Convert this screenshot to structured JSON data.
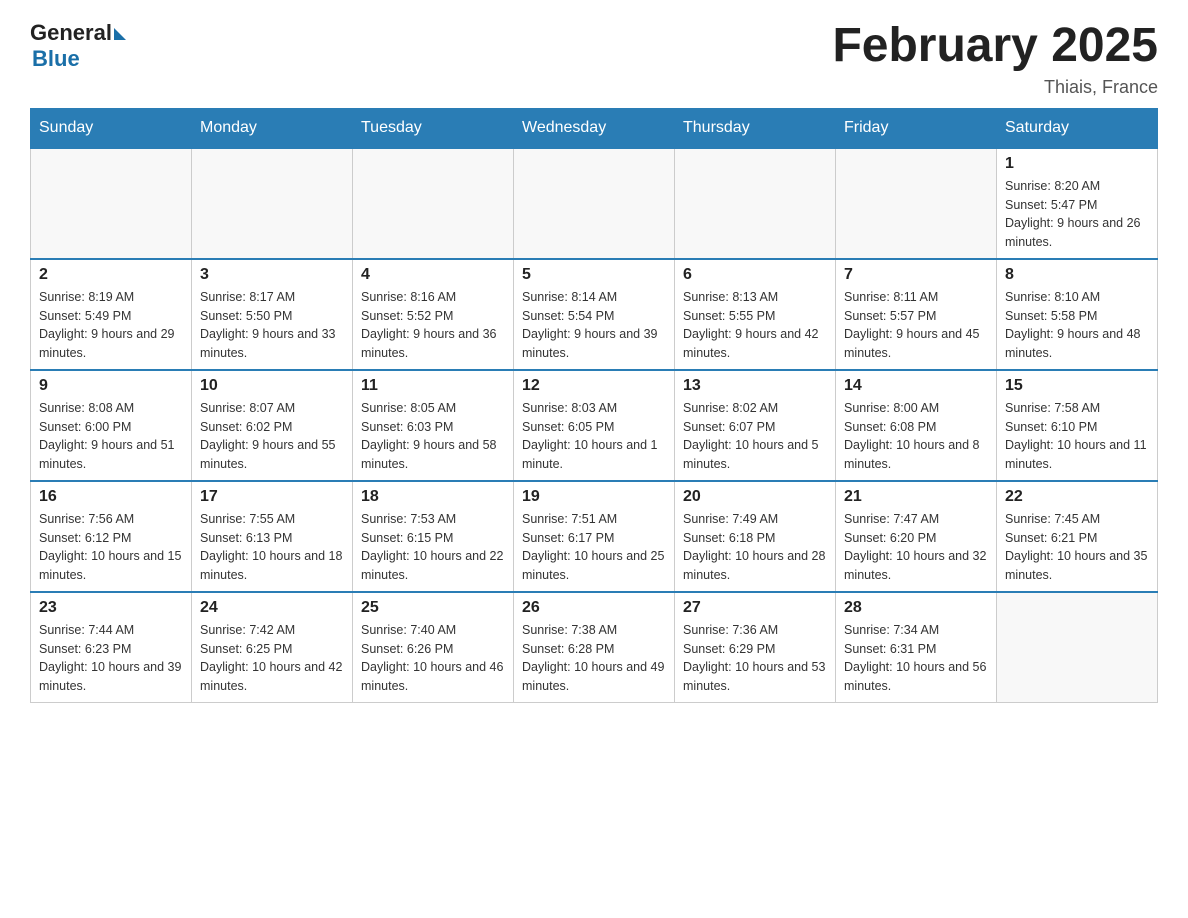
{
  "header": {
    "logo_general": "General",
    "logo_blue": "Blue",
    "month_title": "February 2025",
    "location": "Thiais, France"
  },
  "days_of_week": [
    "Sunday",
    "Monday",
    "Tuesday",
    "Wednesday",
    "Thursday",
    "Friday",
    "Saturday"
  ],
  "weeks": [
    [
      {
        "day": "",
        "info": ""
      },
      {
        "day": "",
        "info": ""
      },
      {
        "day": "",
        "info": ""
      },
      {
        "day": "",
        "info": ""
      },
      {
        "day": "",
        "info": ""
      },
      {
        "day": "",
        "info": ""
      },
      {
        "day": "1",
        "info": "Sunrise: 8:20 AM\nSunset: 5:47 PM\nDaylight: 9 hours and 26 minutes."
      }
    ],
    [
      {
        "day": "2",
        "info": "Sunrise: 8:19 AM\nSunset: 5:49 PM\nDaylight: 9 hours and 29 minutes."
      },
      {
        "day": "3",
        "info": "Sunrise: 8:17 AM\nSunset: 5:50 PM\nDaylight: 9 hours and 33 minutes."
      },
      {
        "day": "4",
        "info": "Sunrise: 8:16 AM\nSunset: 5:52 PM\nDaylight: 9 hours and 36 minutes."
      },
      {
        "day": "5",
        "info": "Sunrise: 8:14 AM\nSunset: 5:54 PM\nDaylight: 9 hours and 39 minutes."
      },
      {
        "day": "6",
        "info": "Sunrise: 8:13 AM\nSunset: 5:55 PM\nDaylight: 9 hours and 42 minutes."
      },
      {
        "day": "7",
        "info": "Sunrise: 8:11 AM\nSunset: 5:57 PM\nDaylight: 9 hours and 45 minutes."
      },
      {
        "day": "8",
        "info": "Sunrise: 8:10 AM\nSunset: 5:58 PM\nDaylight: 9 hours and 48 minutes."
      }
    ],
    [
      {
        "day": "9",
        "info": "Sunrise: 8:08 AM\nSunset: 6:00 PM\nDaylight: 9 hours and 51 minutes."
      },
      {
        "day": "10",
        "info": "Sunrise: 8:07 AM\nSunset: 6:02 PM\nDaylight: 9 hours and 55 minutes."
      },
      {
        "day": "11",
        "info": "Sunrise: 8:05 AM\nSunset: 6:03 PM\nDaylight: 9 hours and 58 minutes."
      },
      {
        "day": "12",
        "info": "Sunrise: 8:03 AM\nSunset: 6:05 PM\nDaylight: 10 hours and 1 minute."
      },
      {
        "day": "13",
        "info": "Sunrise: 8:02 AM\nSunset: 6:07 PM\nDaylight: 10 hours and 5 minutes."
      },
      {
        "day": "14",
        "info": "Sunrise: 8:00 AM\nSunset: 6:08 PM\nDaylight: 10 hours and 8 minutes."
      },
      {
        "day": "15",
        "info": "Sunrise: 7:58 AM\nSunset: 6:10 PM\nDaylight: 10 hours and 11 minutes."
      }
    ],
    [
      {
        "day": "16",
        "info": "Sunrise: 7:56 AM\nSunset: 6:12 PM\nDaylight: 10 hours and 15 minutes."
      },
      {
        "day": "17",
        "info": "Sunrise: 7:55 AM\nSunset: 6:13 PM\nDaylight: 10 hours and 18 minutes."
      },
      {
        "day": "18",
        "info": "Sunrise: 7:53 AM\nSunset: 6:15 PM\nDaylight: 10 hours and 22 minutes."
      },
      {
        "day": "19",
        "info": "Sunrise: 7:51 AM\nSunset: 6:17 PM\nDaylight: 10 hours and 25 minutes."
      },
      {
        "day": "20",
        "info": "Sunrise: 7:49 AM\nSunset: 6:18 PM\nDaylight: 10 hours and 28 minutes."
      },
      {
        "day": "21",
        "info": "Sunrise: 7:47 AM\nSunset: 6:20 PM\nDaylight: 10 hours and 32 minutes."
      },
      {
        "day": "22",
        "info": "Sunrise: 7:45 AM\nSunset: 6:21 PM\nDaylight: 10 hours and 35 minutes."
      }
    ],
    [
      {
        "day": "23",
        "info": "Sunrise: 7:44 AM\nSunset: 6:23 PM\nDaylight: 10 hours and 39 minutes."
      },
      {
        "day": "24",
        "info": "Sunrise: 7:42 AM\nSunset: 6:25 PM\nDaylight: 10 hours and 42 minutes."
      },
      {
        "day": "25",
        "info": "Sunrise: 7:40 AM\nSunset: 6:26 PM\nDaylight: 10 hours and 46 minutes."
      },
      {
        "day": "26",
        "info": "Sunrise: 7:38 AM\nSunset: 6:28 PM\nDaylight: 10 hours and 49 minutes."
      },
      {
        "day": "27",
        "info": "Sunrise: 7:36 AM\nSunset: 6:29 PM\nDaylight: 10 hours and 53 minutes."
      },
      {
        "day": "28",
        "info": "Sunrise: 7:34 AM\nSunset: 6:31 PM\nDaylight: 10 hours and 56 minutes."
      },
      {
        "day": "",
        "info": ""
      }
    ]
  ]
}
